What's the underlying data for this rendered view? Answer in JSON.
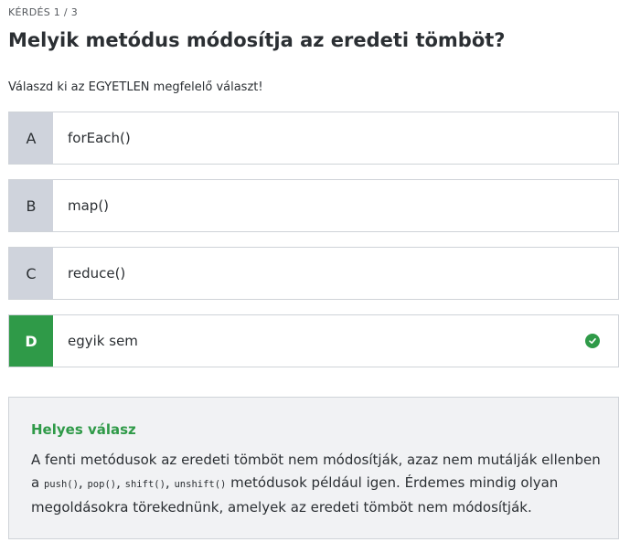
{
  "counter": "KÉRDÉS 1 / 3",
  "question": "Melyik metódus módosítja az eredeti tömböt?",
  "instruction": "Válaszd ki az EGYETLEN megfelelő választ!",
  "options": [
    {
      "letter": "A",
      "text": "forEach()"
    },
    {
      "letter": "B",
      "text": "map()"
    },
    {
      "letter": "C",
      "text": "reduce()"
    },
    {
      "letter": "D",
      "text": "egyik sem"
    }
  ],
  "correct_option": "D",
  "feedback": {
    "title": "Helyes válasz",
    "body_1": "A fenti metódusok az eredeti tömböt nem módosítják, azaz nem mutálják ellenben a",
    "code_1": "push()",
    "sep_1": ",",
    "code_2": "pop()",
    "sep_2": ",",
    "code_3": "shift()",
    "sep_3": ",",
    "code_4": "unshift()",
    "body_2": "metódusok például igen. Érdemes mindig olyan megoldásokra törekednünk, amelyek az eredeti tömböt nem módosítják."
  },
  "colors": {
    "correct": "#2f9a48",
    "letter_bg": "#cfd3dc",
    "border": "#cfd3d8",
    "feedback_bg": "#f1f2f4"
  },
  "icons": {
    "correct": "check-circle-icon"
  }
}
